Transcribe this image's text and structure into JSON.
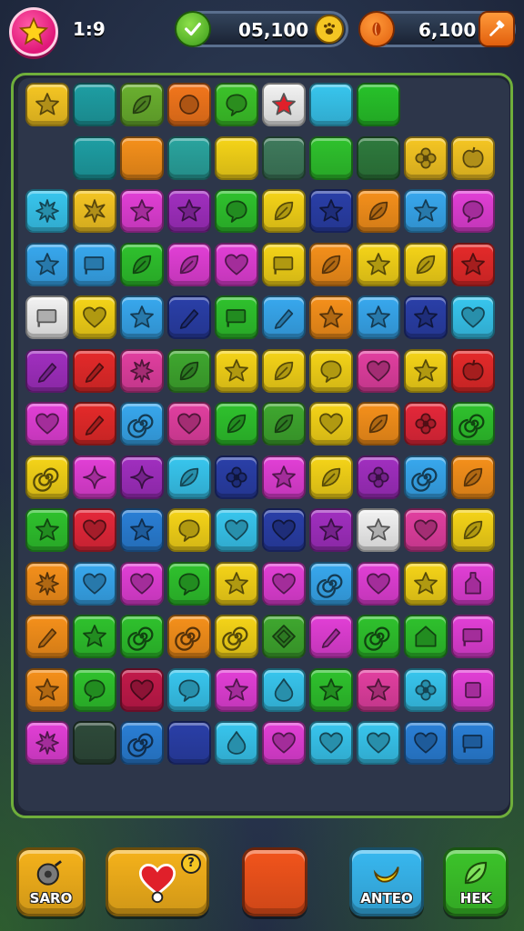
{
  "hud": {
    "moves": "1:9",
    "score": "05,100",
    "coins": "6,100"
  },
  "board": {
    "rows": [
      [
        [
          "#f5c623",
          "star"
        ],
        [
          "#1e9ea3",
          ""
        ],
        [
          "#6ab02f",
          "leaf"
        ],
        [
          "#f2761c",
          "circle"
        ],
        [
          "#3cc42a",
          "bubble"
        ],
        [
          "#f2f2f2",
          "star-red"
        ],
        [
          "#38c6ee",
          ""
        ],
        [
          "#27c22a",
          ""
        ],
        null,
        null
      ],
      [
        null,
        [
          "#1e9ea3",
          ""
        ],
        [
          "#f5901b",
          ""
        ],
        [
          "#2aa49e",
          ""
        ],
        [
          "#f5d418",
          ""
        ],
        [
          "#3f7a5c",
          ""
        ],
        [
          "#2fc22d",
          ""
        ],
        [
          "#2e7a3d",
          ""
        ],
        [
          "#f5c623",
          "flower"
        ],
        [
          "#f5c623",
          "apple"
        ]
      ],
      [
        [
          "#38c6ee",
          "splat"
        ],
        [
          "#f5c623",
          "burst"
        ],
        [
          "#e23fd6",
          "star"
        ],
        [
          "#a12fc0",
          "star"
        ],
        [
          "#2fc22d",
          "bubble"
        ],
        [
          "#f5d418",
          "leaf"
        ],
        [
          "#2a3fa8",
          "star"
        ],
        [
          "#f5901b",
          "leaf"
        ],
        [
          "#38a8ee",
          "star"
        ],
        [
          "#e23fd6",
          "bubble"
        ]
      ],
      [
        [
          "#38a8ee",
          "star"
        ],
        [
          "#38a8ee",
          "flag"
        ],
        [
          "#2fc22d",
          "leaf"
        ],
        [
          "#e23fd6",
          "leaf"
        ],
        [
          "#e23fd6",
          "heart"
        ],
        [
          "#f5d418",
          "flag"
        ],
        [
          "#f5901b",
          "leaf"
        ],
        [
          "#f5d418",
          "star"
        ],
        [
          "#f5d418",
          "leaf"
        ],
        [
          "#e52a2a",
          "star"
        ]
      ],
      [
        [
          "#f2f2f2",
          "flag"
        ],
        [
          "#f5d418",
          "heart"
        ],
        [
          "#38a8ee",
          "star"
        ],
        [
          "#2a3fa8",
          "pencil"
        ],
        [
          "#2fc22d",
          "flag"
        ],
        [
          "#38a8ee",
          "pencil"
        ],
        [
          "#f5901b",
          "star"
        ],
        [
          "#38a8ee",
          "star"
        ],
        [
          "#2a3fa8",
          "star"
        ],
        [
          "#38c6ee",
          "heart"
        ]
      ],
      [
        [
          "#a12fc0",
          "pencil"
        ],
        [
          "#e52a2a",
          "pencil"
        ],
        [
          "#e23fa0",
          "splat"
        ],
        [
          "#3fa82f",
          "leaf"
        ],
        [
          "#f5d418",
          "star"
        ],
        [
          "#f5d418",
          "leaf"
        ],
        [
          "#f5d418",
          "bubble"
        ],
        [
          "#e23fa0",
          "heart"
        ],
        [
          "#f5d418",
          "star"
        ],
        [
          "#e52a2a",
          "apple"
        ]
      ],
      [
        [
          "#e23fd6",
          "heart"
        ],
        [
          "#e52a2a",
          "pencil"
        ],
        [
          "#38a8ee",
          "spiral"
        ],
        [
          "#e23fa0",
          "heart"
        ],
        [
          "#2fc22d",
          "leaf"
        ],
        [
          "#3fa82f",
          "leaf"
        ],
        [
          "#f5d418",
          "heart"
        ],
        [
          "#f5901b",
          "leaf"
        ],
        [
          "#e5283a",
          "flower"
        ],
        [
          "#2fc22d",
          "spiral"
        ]
      ],
      [
        [
          "#f5d418",
          "spiral"
        ],
        [
          "#e23fd6",
          "sparkle"
        ],
        [
          "#a12fc0",
          "sparkle"
        ],
        [
          "#38c6ee",
          "leaf"
        ],
        [
          "#2a3fa8",
          "flower"
        ],
        [
          "#e23fd6",
          "star"
        ],
        [
          "#f5d418",
          "leaf"
        ],
        [
          "#a12fc0",
          "flower"
        ],
        [
          "#38a8ee",
          "spiral"
        ],
        [
          "#f5901b",
          "leaf"
        ]
      ],
      [
        [
          "#2fc22d",
          "star"
        ],
        [
          "#e5283a",
          "heart"
        ],
        [
          "#2a7fd6",
          "star"
        ],
        [
          "#f5d418",
          "bubble"
        ],
        [
          "#38c6ee",
          "heart"
        ],
        [
          "#2a3fa8",
          "heart"
        ],
        [
          "#a12fc0",
          "star"
        ],
        [
          "#f2f2f2",
          "star"
        ],
        [
          "#e23fa0",
          "heart"
        ],
        [
          "#f5d418",
          "leaf"
        ]
      ],
      [
        [
          "#f5901b",
          "splat"
        ],
        [
          "#38a8ee",
          "heart"
        ],
        [
          "#e23fd6",
          "heart"
        ],
        [
          "#2fc22d",
          "bubble"
        ],
        [
          "#f5d418",
          "star"
        ],
        [
          "#e23fd6",
          "heart"
        ],
        [
          "#38a8ee",
          "spiral"
        ],
        [
          "#e23fd6",
          "heart"
        ],
        [
          "#f5d418",
          "star"
        ],
        [
          "#e23fd6",
          "bottle"
        ]
      ],
      [
        [
          "#f5901b",
          "pencil"
        ],
        [
          "#2fc22d",
          "star"
        ],
        [
          "#2fc22d",
          "spiral"
        ],
        [
          "#f5901b",
          "spiral"
        ],
        [
          "#f5d418",
          "spiral"
        ],
        [
          "#3fa82f",
          "diamond"
        ],
        [
          "#e23fd6",
          "pencil"
        ],
        [
          "#2fc22d",
          "spiral"
        ],
        [
          "#2fc22d",
          "house"
        ],
        [
          "#e23fd6",
          "flag"
        ]
      ],
      [
        [
          "#f5901b",
          "star"
        ],
        [
          "#2fc22d",
          "bubble"
        ],
        [
          "#c21a4a",
          "heart"
        ],
        [
          "#38c6ee",
          "bubble"
        ],
        [
          "#e23fd6",
          "star"
        ],
        [
          "#38c6ee",
          "drop"
        ],
        [
          "#2fc22d",
          "star"
        ],
        [
          "#e23fa0",
          "star"
        ],
        [
          "#38c6ee",
          "flower"
        ],
        [
          "#e23fd6",
          "square"
        ]
      ],
      [
        [
          "#e23fd6",
          "splat"
        ],
        [
          "#2e4a3a",
          ""
        ],
        [
          "#2a7fd6",
          "spiral"
        ],
        [
          "#2a3fa8",
          ""
        ],
        [
          "#38c6ee",
          "drop"
        ],
        [
          "#e23fd6",
          "heart"
        ],
        [
          "#38c6ee",
          "heart"
        ],
        [
          "#38c6ee",
          "heart"
        ],
        [
          "#2a7fd6",
          "heart"
        ],
        [
          "#2a7fd6",
          "flag"
        ]
      ]
    ]
  },
  "bottom": {
    "buttons": [
      {
        "label": "SARO",
        "color": "#f5b21b",
        "icon": "gear-bomb-icon"
      },
      {
        "label": "",
        "color": "#f5b21b",
        "icon": "heart-basket-icon"
      },
      {
        "label": "",
        "color": "#f2541c",
        "icon": ""
      },
      {
        "label": "ANTEO",
        "color": "#38b8f0",
        "icon": "banana-icon"
      },
      {
        "label": "HEK",
        "color": "#3cc42a",
        "icon": "leaf-icon"
      }
    ]
  }
}
